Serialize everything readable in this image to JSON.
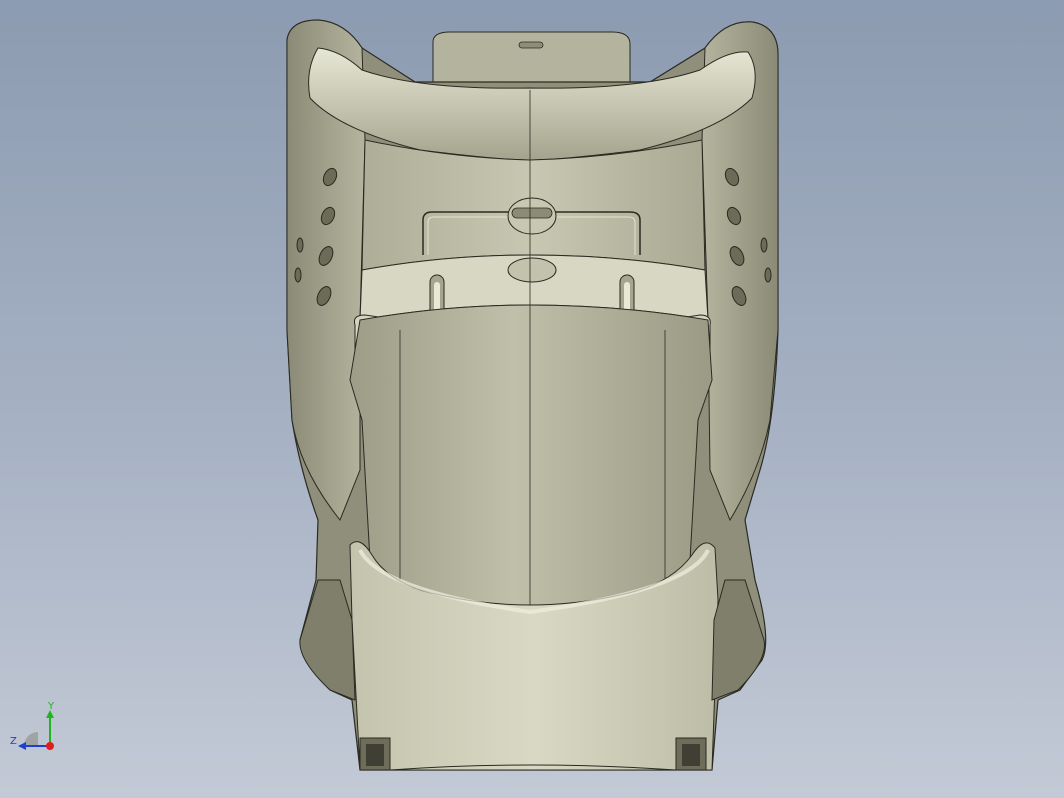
{
  "triad": {
    "y_label": "Y",
    "z_label": "Z",
    "y_color": "#1fb51f",
    "z_color": "#1c3fd6",
    "x_color": "#e01e1e"
  },
  "model": {
    "shell_color": "#b9b8a1",
    "shell_shadow": "#6e6d5c",
    "edge_color": "#2a2a22"
  }
}
